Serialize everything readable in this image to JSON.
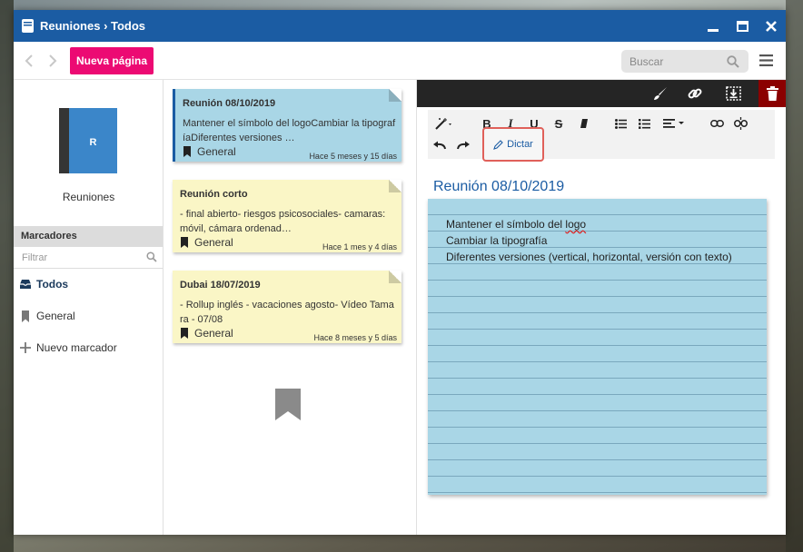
{
  "window": {
    "title": "Reuniones › Todos",
    "controls": [
      "minimize-icon",
      "maximize-icon",
      "close-icon"
    ]
  },
  "toolbar": {
    "new_page_label": "Nueva página",
    "search_placeholder": "Buscar"
  },
  "sidebar": {
    "notebook_letter": "R",
    "notebook_name": "Reuniones",
    "bookmarks_header": "Marcadores",
    "filter_placeholder": "Filtrar",
    "items": [
      {
        "label": "Todos",
        "icon": "inbox-icon",
        "active": true
      },
      {
        "label": "General",
        "icon": "bookmark-icon",
        "active": false
      },
      {
        "label": "Nuevo marcador",
        "icon": "plus-icon",
        "active": false
      }
    ]
  },
  "notes": [
    {
      "title": "Reunión 08/10/2019",
      "body": "Mantener el símbolo del logoCambiar la tipografíaDiferentes versiones …",
      "tag": "General",
      "date": "Hace 5 meses y 15 días",
      "color": "#a9d6e6",
      "selected": true
    },
    {
      "title": "Reunión corto",
      "body": "- final abierto- riesgos psicosociales- camaras: móvil, cámara ordenad…",
      "tag": "General",
      "date": "Hace 1 mes y 4 días",
      "color": "#faf6c6",
      "selected": false
    },
    {
      "title": "Dubai 18/07/2019",
      "body": "- Rollup inglés - vacaciones agosto- Vídeo Tamara - 07/08",
      "tag": "General",
      "date": "Hace 8 meses y 5 días",
      "color": "#faf6c6",
      "selected": false
    }
  ],
  "editor": {
    "top_icons": [
      "brush-icon",
      "link-icon",
      "insert-icon",
      "trash-icon"
    ],
    "format_buttons": {
      "bold": "B",
      "italic": "I",
      "underline": "U",
      "strike": "S"
    },
    "dictate_label": "Dictar",
    "note_title": "Reunión 08/10/2019",
    "lines": [
      "Mantener el símbolo del logo",
      "Cambiar la tipografía",
      "Diferentes versiones (vertical, horizontal, versión con texto)"
    ]
  },
  "colors": {
    "titlebar": "#1b5ca3",
    "new_page_button": "#ec0a73",
    "trash_button": "#8b0000",
    "dictate_highlight": "#e0605a"
  }
}
